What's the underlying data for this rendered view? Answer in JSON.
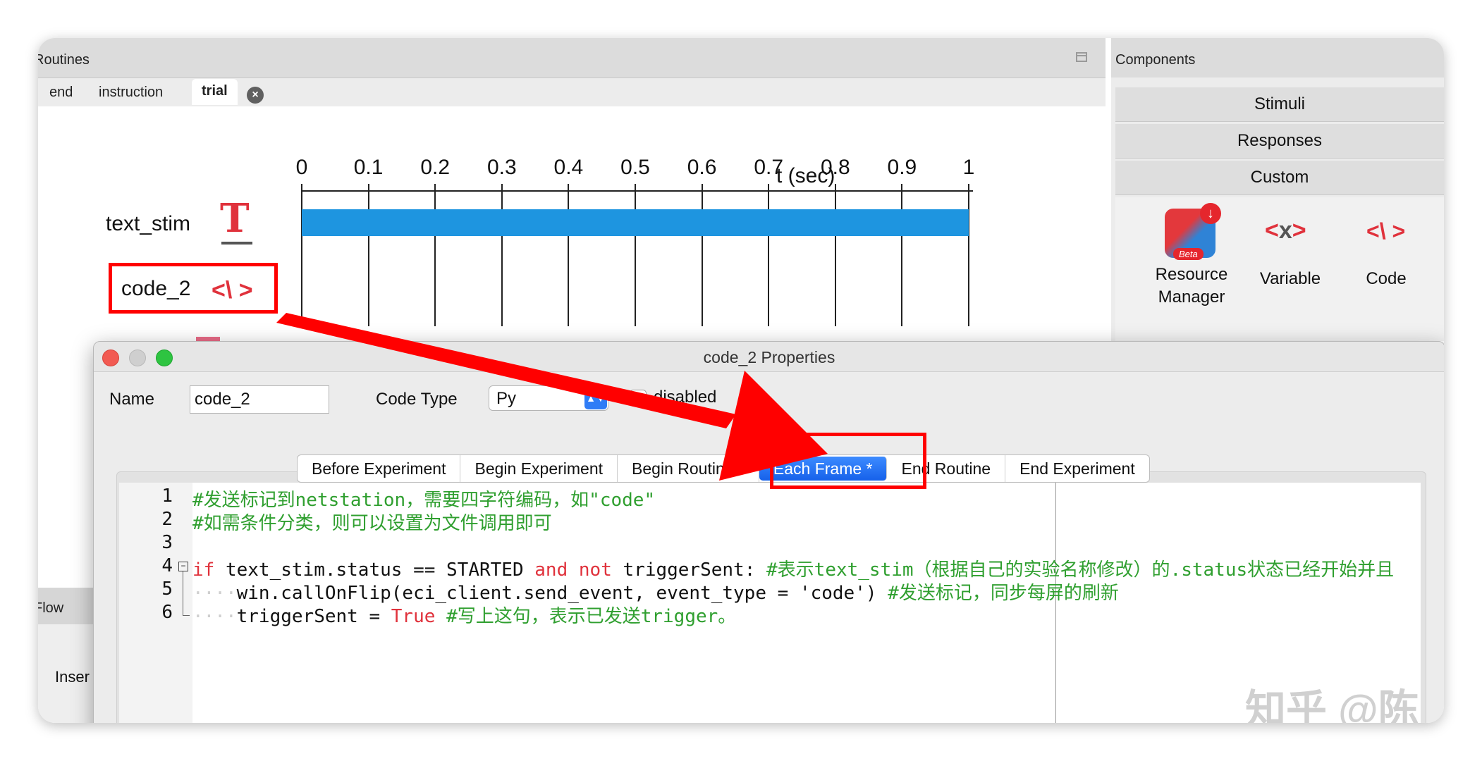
{
  "routines": {
    "title": "Routines",
    "tabs": [
      "end",
      "instruction",
      "trial"
    ],
    "active_tab": "trial",
    "close_symbol": "×"
  },
  "timeline": {
    "ticks": [
      "0",
      "0.1",
      "0.2",
      "0.3",
      "0.4",
      "0.5",
      "0.6",
      "0.7",
      "0.8",
      "0.9",
      "1"
    ],
    "axis_label": "t (sec)",
    "components": [
      {
        "name": "text_stim",
        "icon": "text-icon",
        "icon_glyph": "T",
        "start": 0,
        "stop": 1
      },
      {
        "name": "code_2",
        "icon": "code-icon",
        "icon_glyph": "<\\ >"
      }
    ],
    "bar_color": "#1e95e0"
  },
  "flow": {
    "title": "Flow",
    "insert_label": "Inser"
  },
  "components_panel": {
    "title": "Components",
    "categories": [
      "Stimuli",
      "Responses",
      "Custom"
    ],
    "items": [
      {
        "label_line1": "Resource",
        "label_line2": "Manager",
        "icon": "resource-manager-icon",
        "badge": "Beta",
        "download_glyph": "↓"
      },
      {
        "label": "Variable",
        "icon": "variable-icon",
        "glyph_left": "<",
        "glyph_mid": "x",
        "glyph_right": ">"
      },
      {
        "label": "Code",
        "icon": "code-icon",
        "glyph": "<\\ >"
      }
    ]
  },
  "dialog": {
    "title": "code_2 Properties",
    "name_label": "Name",
    "name_value": "code_2",
    "code_type_label": "Code Type",
    "code_type_value": "Py",
    "disabled_label": "disabled",
    "tabs": [
      "Before Experiment",
      "Begin Experiment",
      "Begin Routine *",
      "Each Frame *",
      "End Routine",
      "End Experiment"
    ],
    "active_tab": "Each Frame *",
    "code": {
      "line_numbers": [
        "1",
        "2",
        "3",
        "4",
        "5",
        "6"
      ],
      "l1": "#发送标记到netstation，需要四字符编码，如\"code\"",
      "l2": "#如需条件分类，则可以设置为文件调用即可",
      "l4_if": "if",
      "l4_a": " text_stim.status == STARTED ",
      "l4_and": "and",
      "l4_sp": " ",
      "l4_not": "not",
      "l4_b": " triggerSent: ",
      "l4_comment": "#表示text_stim（根据自己的实验名称修改）的.status状态已经开始并且",
      "l5_indent": "····",
      "l5_code": "win.callOnFlip(eci_client.send_event, event_type = 'code') ",
      "l5_comment": "#发送标记，同步每屏的刷新",
      "l6_indent": "····",
      "l6_a": "triggerSent = ",
      "l6_true": "True",
      "l6_sp": " ",
      "l6_comment": "#写上这句，表示已发送trigger。"
    }
  },
  "annotation": {
    "color": "#ff0000"
  },
  "watermark": "知乎 @陈锐"
}
